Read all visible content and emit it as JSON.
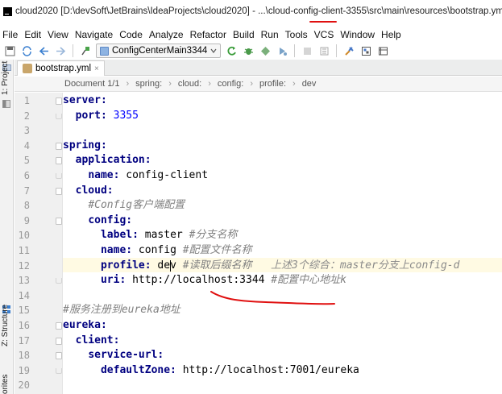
{
  "window": {
    "title": "cloud2020 [D:\\devSoft\\JetBrains\\IdeaProjects\\cloud2020] - ...\\cloud-config-client-3355\\src\\main\\resources\\bootstrap.yml [clo"
  },
  "menu": {
    "items": [
      "File",
      "Edit",
      "View",
      "Navigate",
      "Code",
      "Analyze",
      "Refactor",
      "Build",
      "Run",
      "Tools",
      "VCS",
      "Window",
      "Help"
    ]
  },
  "toolbar": {
    "run_config": "ConfigCenterMain3344",
    "icons": [
      "save-all-icon",
      "sync-icon",
      "back-icon",
      "forward-icon",
      "build-icon",
      "run-icon",
      "debug-icon",
      "coverage-icon",
      "profile-icon",
      "stop-icon",
      "project-structure-icon",
      "sdk-icon",
      "sdk-manager-icon"
    ]
  },
  "side_panels": {
    "project": "1: Project",
    "structure": "Z: Structure",
    "favorites": "orites"
  },
  "tabs": [
    {
      "label": "bootstrap.yml",
      "close": "×"
    }
  ],
  "breadcrumb": {
    "items": [
      "Document 1/1",
      "spring:",
      "cloud:",
      "config:",
      "profile:",
      "dev"
    ],
    "separator": "›"
  },
  "editor": {
    "line_numbers": [
      "1",
      "2",
      "3",
      "4",
      "5",
      "6",
      "7",
      "8",
      "9",
      "10",
      "11",
      "12",
      "13",
      "14",
      "15",
      "16",
      "17",
      "18",
      "19",
      "20"
    ],
    "lines": [
      {
        "indent": "",
        "key": "server:",
        "value": "",
        "comment": ""
      },
      {
        "indent": "  ",
        "key": "port:",
        "value_num": " 3355",
        "comment": ""
      },
      {
        "indent": "",
        "key": "",
        "value": "",
        "comment": ""
      },
      {
        "indent": "",
        "key": "spring:",
        "value": "",
        "comment": ""
      },
      {
        "indent": "  ",
        "key": "application:",
        "value": "",
        "comment": ""
      },
      {
        "indent": "    ",
        "key": "name:",
        "value": " config-client",
        "comment": ""
      },
      {
        "indent": "  ",
        "key": "cloud:",
        "value": "",
        "comment": ""
      },
      {
        "indent": "    ",
        "key": "",
        "value": "",
        "comment": "#Config客户端配置"
      },
      {
        "indent": "    ",
        "key": "config:",
        "value": "",
        "comment": ""
      },
      {
        "indent": "      ",
        "key": "label:",
        "value": " master ",
        "comment": "#分支名称"
      },
      {
        "indent": "      ",
        "key": "name:",
        "value": " config ",
        "comment": "#配置文件名称"
      },
      {
        "indent": "      ",
        "key": "profile:",
        "value": " dev ",
        "comment": "#读取后缀名称",
        "inlay": "   上述3个综合：master分支上config-d"
      },
      {
        "indent": "      ",
        "key": "uri:",
        "value": " http://localhost:3344 ",
        "comment": "#配置中心地址k"
      },
      {
        "indent": "",
        "key": "",
        "value": "",
        "comment": ""
      },
      {
        "indent": "",
        "key": "",
        "value": "",
        "comment": "#服务注册到eureka地址"
      },
      {
        "indent": "",
        "key": "eureka:",
        "value": "",
        "comment": ""
      },
      {
        "indent": "  ",
        "key": "client:",
        "value": "",
        "comment": ""
      },
      {
        "indent": "    ",
        "key": "service-url:",
        "value": "",
        "comment": ""
      },
      {
        "indent": "      ",
        "key": "defaultZone:",
        "value": " http://localhost:7001/eureka",
        "comment": ""
      },
      {
        "indent": "",
        "key": "",
        "value": "",
        "comment": ""
      }
    ],
    "current_line": 12
  },
  "annotations": {
    "color": "#e01010"
  }
}
